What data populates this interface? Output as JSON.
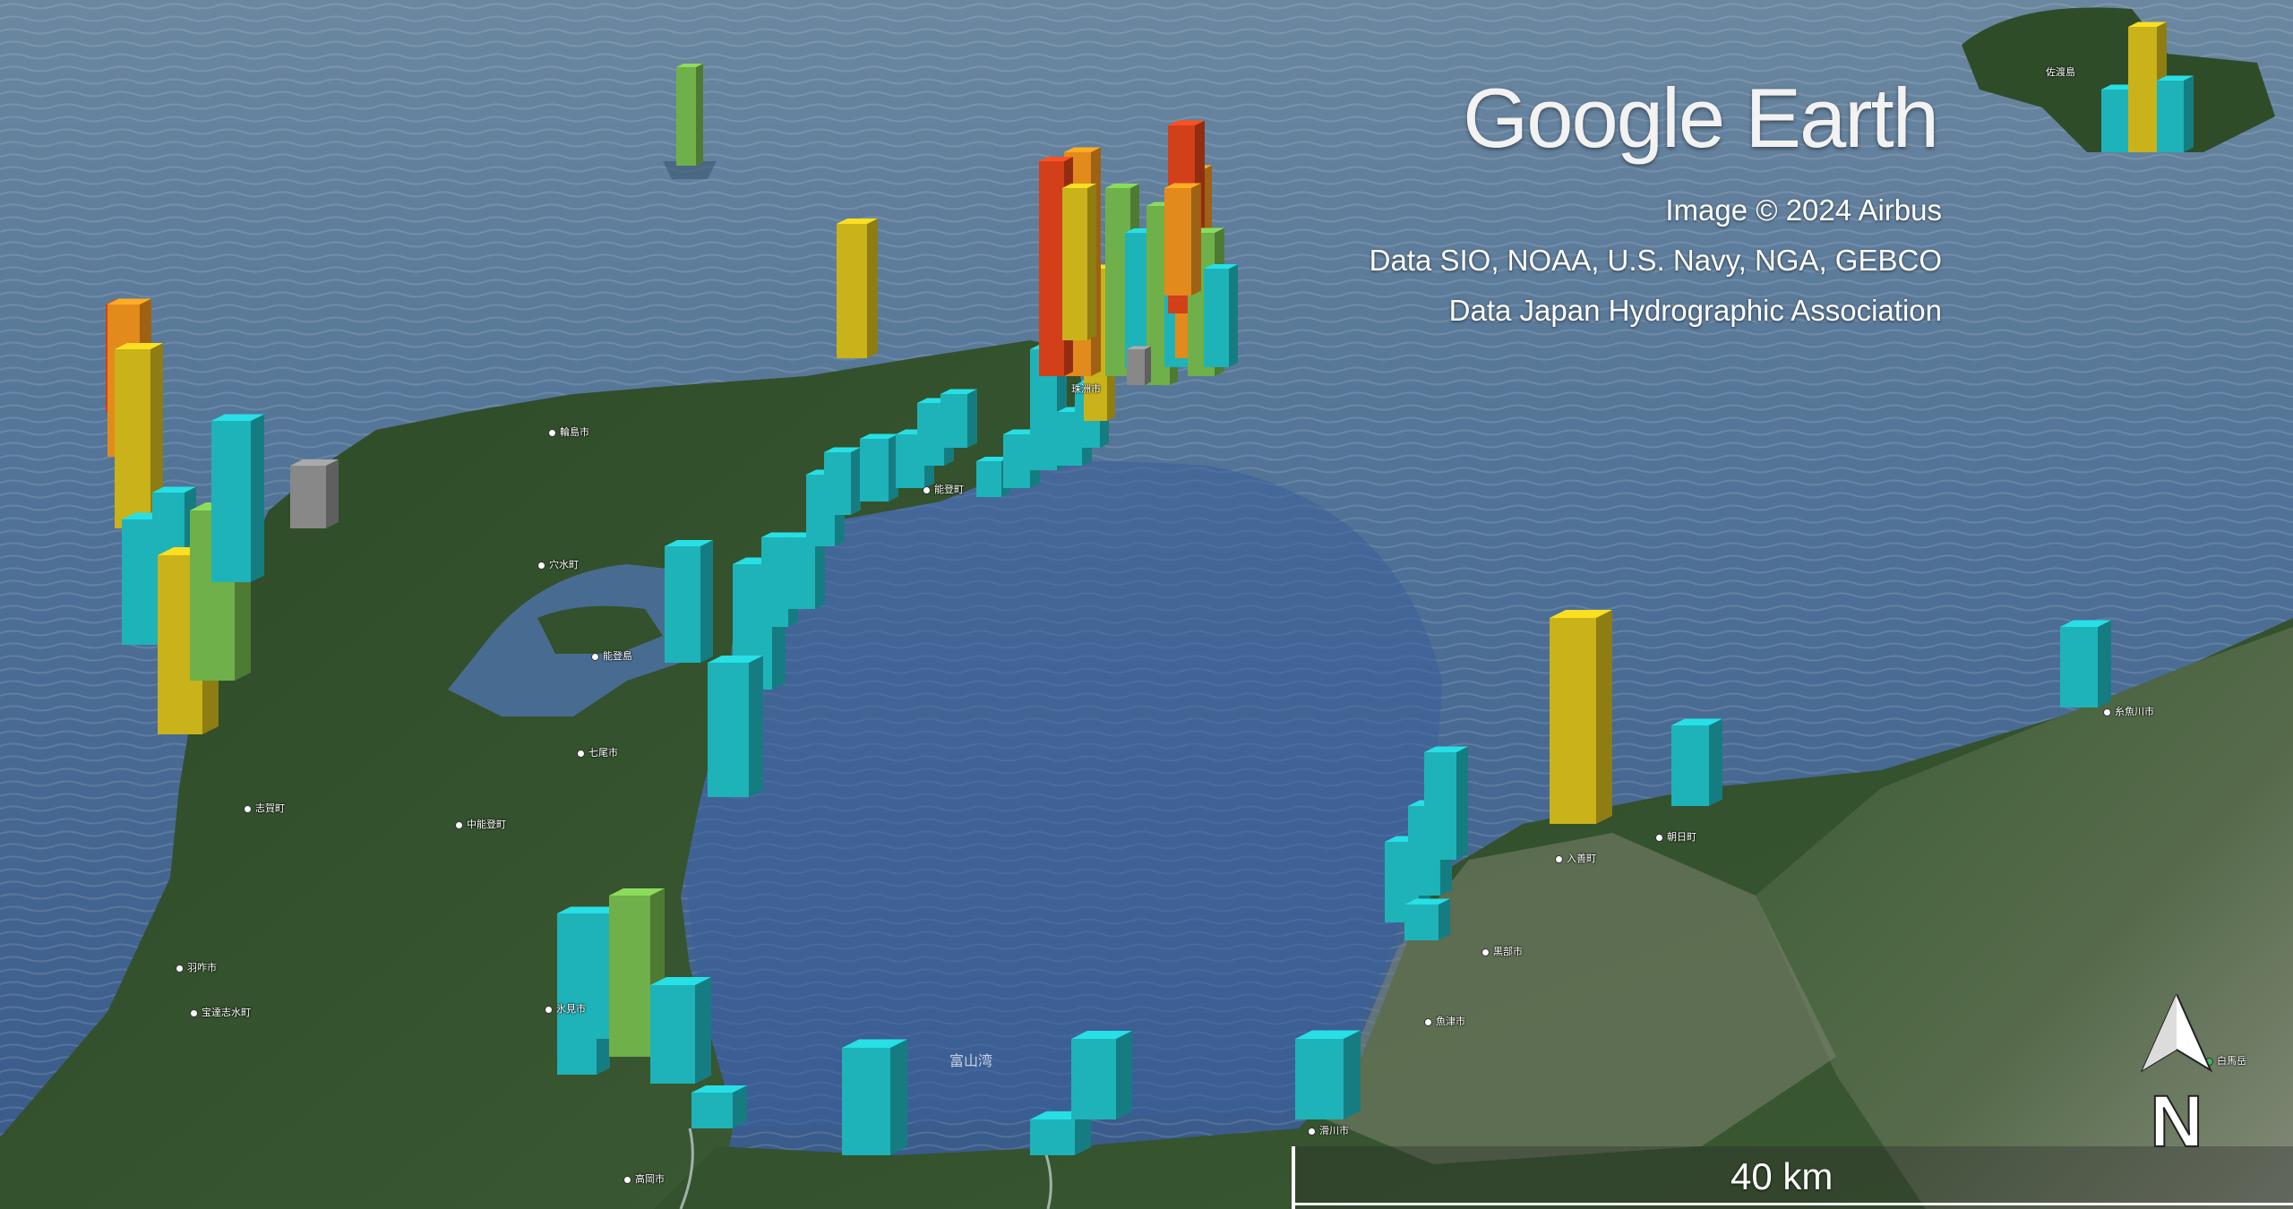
{
  "map": {
    "logo_text": "Google Earth",
    "attribution": [
      "Image © 2024 Airbus",
      "Data SIO, NOAA, U.S. Navy, NGA, GEBCO",
      "Data Japan Hydrographic Association"
    ],
    "scale_label": "40 km",
    "north_label": "N",
    "bay_label": "富山湾",
    "places": [
      {
        "label": "輪島市"
      },
      {
        "label": "穴水町"
      },
      {
        "label": "能登島"
      },
      {
        "label": "七尾市"
      },
      {
        "label": "中能登町"
      },
      {
        "label": "志賀町"
      },
      {
        "label": "羽咋市"
      },
      {
        "label": "宝達志水町"
      },
      {
        "label": "氷見市"
      },
      {
        "label": "高岡市"
      },
      {
        "label": "滑川市"
      },
      {
        "label": "魚津市"
      },
      {
        "label": "黒部市"
      },
      {
        "label": "入善町"
      },
      {
        "label": "朝日町"
      },
      {
        "label": "糸魚川市"
      },
      {
        "label": "珠洲市"
      },
      {
        "label": "能登町"
      },
      {
        "label": "佐渡島"
      },
      {
        "label": "白馬岳"
      }
    ],
    "colors": {
      "sea": "#3f6690",
      "land": "#2f4a2a",
      "bar_cyan": "#1eb3b8",
      "bar_green": "#6fb04a",
      "bar_yellow": "#c9b21a",
      "bar_orange": "#e38a1c",
      "bar_red": "#d2401a",
      "bar_gray": "#888888"
    }
  }
}
